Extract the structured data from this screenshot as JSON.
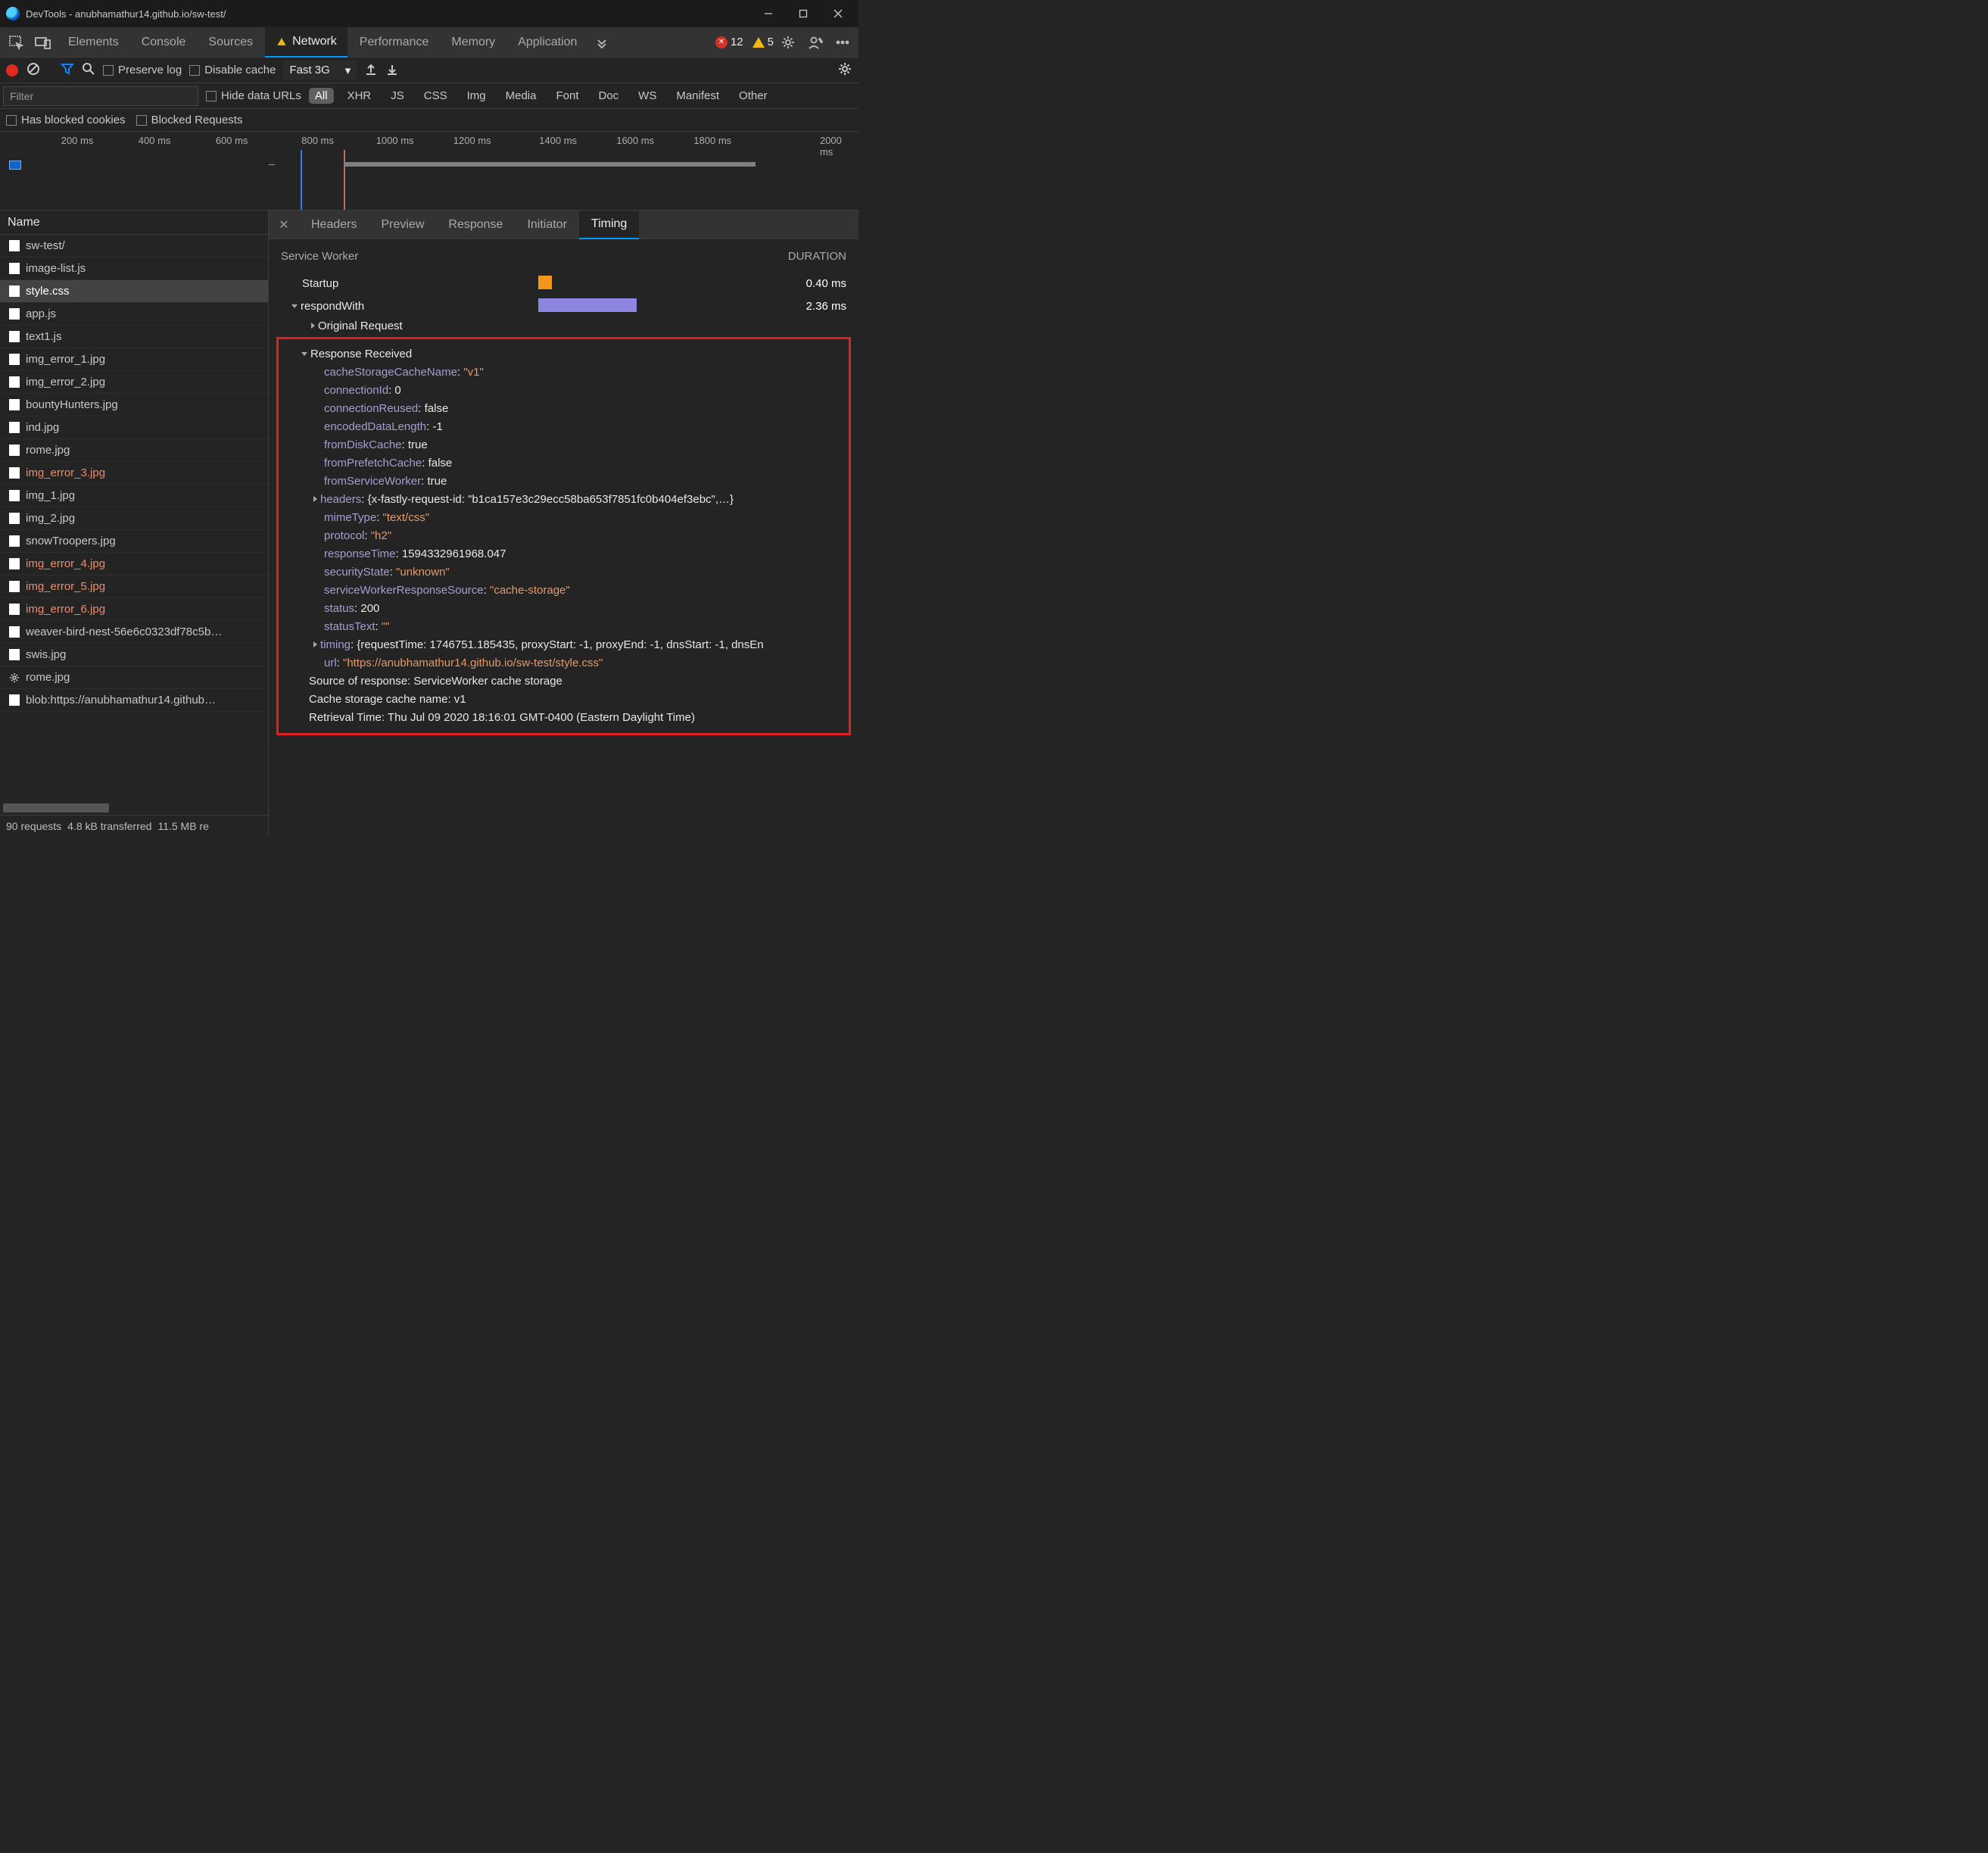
{
  "window": {
    "title": "DevTools - anubhamathur14.github.io/sw-test/"
  },
  "mainTabs": {
    "items": [
      "Elements",
      "Console",
      "Sources",
      "Network",
      "Performance",
      "Memory",
      "Application"
    ],
    "active": "Network",
    "errors": "12",
    "warnings": "5"
  },
  "toolbar1": {
    "preserve_log": "Preserve log",
    "disable_cache": "Disable cache",
    "throttle": "Fast 3G"
  },
  "toolbar2": {
    "filter_placeholder": "Filter",
    "hide_data_urls": "Hide data URLs",
    "chips": [
      "All",
      "XHR",
      "JS",
      "CSS",
      "Img",
      "Media",
      "Font",
      "Doc",
      "WS",
      "Manifest",
      "Other"
    ],
    "active_chip": "All"
  },
  "toolbar3": {
    "has_blocked": "Has blocked cookies",
    "blocked_req": "Blocked Requests"
  },
  "waterfall": {
    "ticks": [
      "200 ms",
      "400 ms",
      "600 ms",
      "800 ms",
      "1000 ms",
      "1200 ms",
      "1400 ms",
      "1600 ms",
      "1800 ms",
      "2000 ms"
    ]
  },
  "left": {
    "header": "Name",
    "rows": [
      {
        "name": "sw-test/",
        "error": false
      },
      {
        "name": "image-list.js",
        "error": false
      },
      {
        "name": "style.css",
        "error": false,
        "selected": true
      },
      {
        "name": "app.js",
        "error": false
      },
      {
        "name": "text1.js",
        "error": false
      },
      {
        "name": "img_error_1.jpg",
        "error": false
      },
      {
        "name": "img_error_2.jpg",
        "error": false
      },
      {
        "name": "bountyHunters.jpg",
        "error": false
      },
      {
        "name": "ind.jpg",
        "error": false
      },
      {
        "name": "rome.jpg",
        "error": false
      },
      {
        "name": "img_error_3.jpg",
        "error": true
      },
      {
        "name": "img_1.jpg",
        "error": false
      },
      {
        "name": "img_2.jpg",
        "error": false
      },
      {
        "name": "snowTroopers.jpg",
        "error": false
      },
      {
        "name": "img_error_4.jpg",
        "error": true
      },
      {
        "name": "img_error_5.jpg",
        "error": true
      },
      {
        "name": "img_error_6.jpg",
        "error": true
      },
      {
        "name": "weaver-bird-nest-56e6c0323df78c5b…",
        "error": false
      },
      {
        "name": "swis.jpg",
        "error": false
      },
      {
        "name": "rome.jpg",
        "error": false,
        "gear": true
      },
      {
        "name": "blob:https://anubhamathur14.github…",
        "error": false
      }
    ],
    "status": {
      "requests": "90 requests",
      "transferred": "4.8 kB transferred",
      "resources": "11.5 MB re"
    }
  },
  "right": {
    "tabs": [
      "Headers",
      "Preview",
      "Response",
      "Initiator",
      "Timing"
    ],
    "active": "Timing",
    "timing": {
      "section": "Service Worker",
      "duration_hdr": "DURATION",
      "rows": [
        {
          "label": "Startup",
          "duration": "0.40 ms"
        },
        {
          "label": "respondWith",
          "duration": "2.36 ms"
        }
      ],
      "original_request": "Original Request",
      "response_received": "Response Received",
      "details": {
        "cacheStorageCacheName": "\"v1\"",
        "connectionId": "0",
        "connectionReused": "false",
        "encodedDataLength": "-1",
        "fromDiskCache": "true",
        "fromPrefetchCache": "false",
        "fromServiceWorker": "true",
        "headers": "{x-fastly-request-id: \"b1ca157e3c29ecc58ba653f7851fc0b404ef3ebc\",…}",
        "mimeType": "\"text/css\"",
        "protocol": "\"h2\"",
        "responseTime": "1594332961968.047",
        "securityState": "\"unknown\"",
        "serviceWorkerResponseSource": "\"cache-storage\"",
        "status": "200",
        "statusText": "\"\"",
        "timing": "{requestTime: 1746751.185435, proxyStart: -1, proxyEnd: -1, dnsStart: -1, dnsEn",
        "url": "\"https://anubhamathur14.github.io/sw-test/style.css\""
      },
      "footer": {
        "source": "Source of response: ServiceWorker cache storage",
        "cache_name": "Cache storage cache name: v1",
        "retrieval": "Retrieval Time: Thu Jul 09 2020 18:16:01 GMT-0400 (Eastern Daylight Time)"
      }
    }
  }
}
